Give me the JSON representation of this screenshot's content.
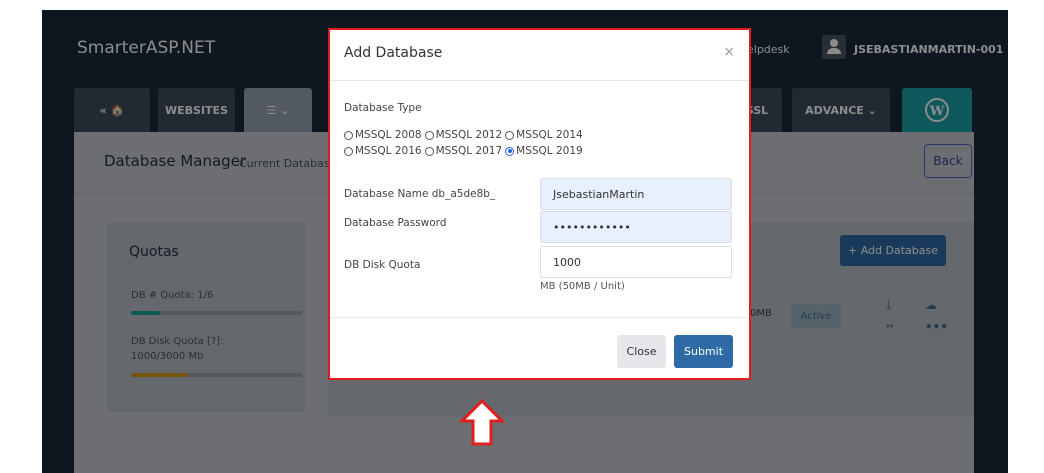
{
  "brand": "SmarterASP.NET",
  "header": {
    "helpdesk": "elpdesk",
    "username": "JSEBASTIANMARTIN-001"
  },
  "tabs": {
    "home": "«  🏠",
    "websites": "WEBSITES",
    "db": "☰  ⌄",
    "ssl": "SSL",
    "advance": "ADVANCE  ⌄",
    "wordpress": "W"
  },
  "page": {
    "title": "Database Manager",
    "subtitle": "Current Database",
    "back": "Back"
  },
  "quotas": {
    "title": "Quotas",
    "db_quota_label": "DB # Quota: 1/6",
    "db_quota_fraction": 0.1667,
    "disk_quota_label_1": "DB Disk Quota [?]:",
    "disk_quota_label_2": "1000/3000 Mb",
    "disk_quota_fraction": 0.3333
  },
  "db_list": {
    "add_button": "+ Add Database",
    "size": "0MB",
    "status": "Active"
  },
  "modal": {
    "title": "Add Database",
    "close_x": "×",
    "db_type_label": "Database Type",
    "db_types": [
      "MSSQL 2008",
      "MSSQL 2012",
      "MSSQL 2014",
      "MSSQL 2016",
      "MSSQL 2017",
      "MSSQL 2019"
    ],
    "selected_type": "MSSQL 2019",
    "name_label": "Database Name db_a5de8b_",
    "name_value": "JsebastianMartin",
    "password_label": "Database Password",
    "password_value": "••••••••••••",
    "quota_label": "DB Disk Quota",
    "quota_value": "1000",
    "quota_hint": "MB (50MB / Unit)",
    "close_button": "Close",
    "submit_button": "Submit"
  },
  "colors": {
    "highlight": "#e11d1d",
    "accent": "#2e6aa6",
    "teal": "#1da0a8",
    "quota_teal": "#1aa39b",
    "quota_orange": "#d99a14"
  }
}
